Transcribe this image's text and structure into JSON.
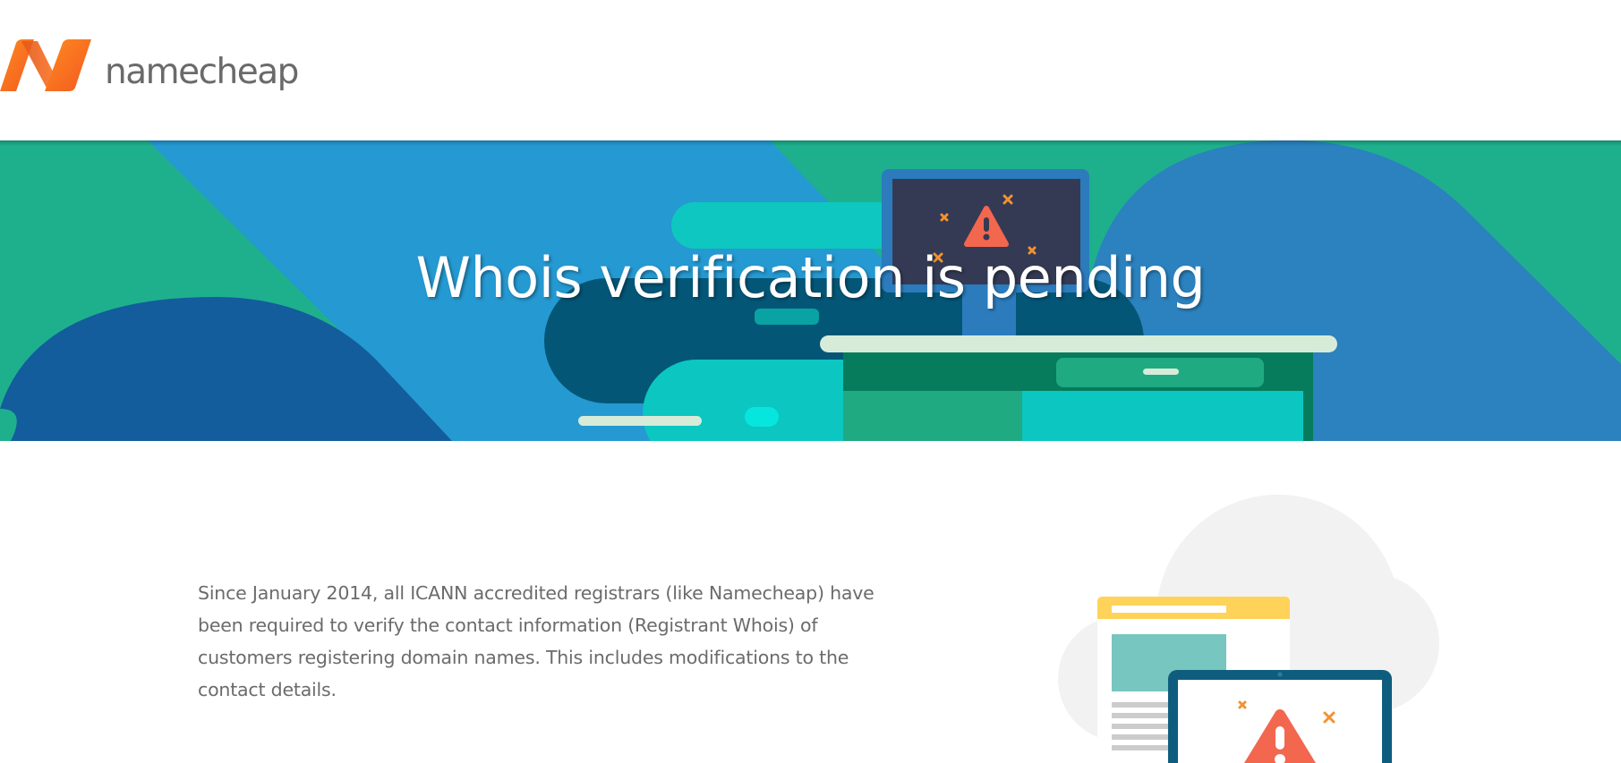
{
  "header": {
    "logo_text": "namecheap",
    "brand_colors": {
      "primary": "#ff6b1a",
      "secondary": "#f15a22"
    }
  },
  "hero": {
    "title": "Whois verification is pending"
  },
  "main": {
    "intro_text": "Since January 2014, all ICANN accredited registrars (like Namecheap) have been required to verify the contact information (Registrant Whois) of customers registering domain names. This includes modifications to the contact details."
  },
  "icons": {
    "hero_alert": "warning-triangle-icon",
    "illustration_alert": "warning-triangle-icon"
  },
  "colors": {
    "hero_green": "#1eb08d",
    "hero_blue": "#2599d1",
    "hero_dark_blue": "#135d9c",
    "alert_red": "#f2674e",
    "alert_orange": "#f39230",
    "text_gray": "#6b6b6b"
  }
}
